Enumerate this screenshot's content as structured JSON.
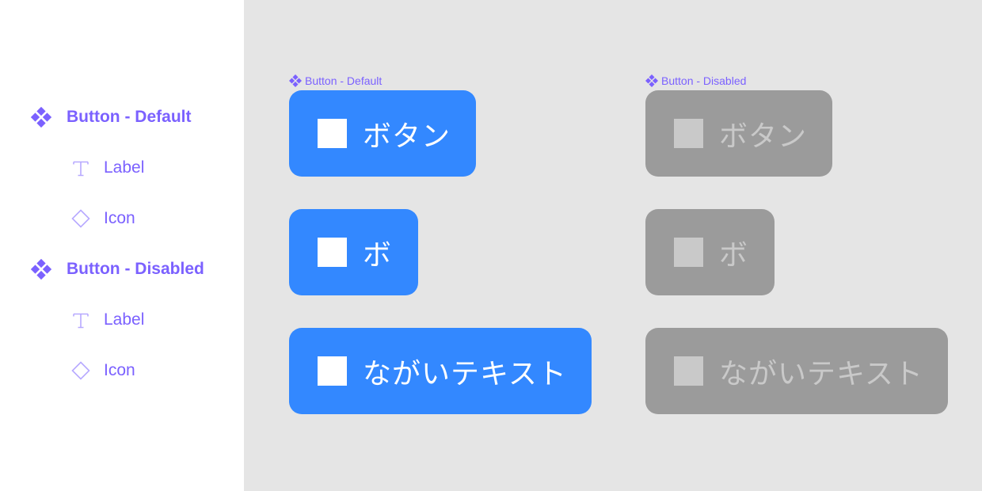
{
  "colors": {
    "accent": "#7b61ff",
    "button_default_bg": "#3388ff",
    "button_disabled_bg": "#9b9b9b",
    "button_disabled_fg": "#c9c9c9",
    "canvas_bg": "#e5e5e5"
  },
  "layers": [
    {
      "label": "Button - Default",
      "icon": "component-icon"
    },
    {
      "label": "Label",
      "icon": "text-icon"
    },
    {
      "label": "Icon",
      "icon": "instance-icon"
    },
    {
      "label": "Button - Disabled",
      "icon": "component-icon"
    },
    {
      "label": "Label",
      "icon": "text-icon"
    },
    {
      "label": "Icon",
      "icon": "instance-icon"
    }
  ],
  "canvas": {
    "default_frame": {
      "title": "Button - Default",
      "buttons": [
        {
          "label": "ボタン"
        },
        {
          "label": "ボ"
        },
        {
          "label": "ながいテキスト"
        }
      ]
    },
    "disabled_frame": {
      "title": "Button - Disabled",
      "buttons": [
        {
          "label": "ボタン"
        },
        {
          "label": "ボ"
        },
        {
          "label": "ながいテキスト"
        }
      ]
    }
  }
}
